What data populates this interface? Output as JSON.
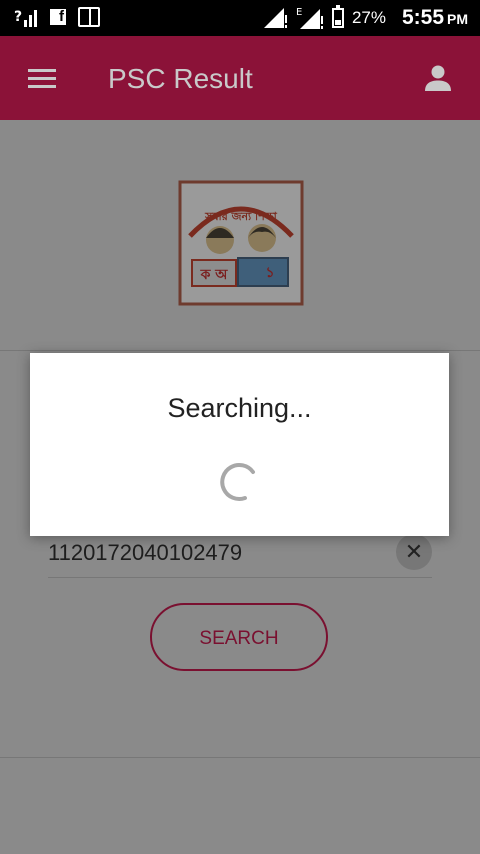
{
  "status_bar": {
    "battery_percent": "27%",
    "time": "5:55",
    "ampm": "PM",
    "signal_label": "E"
  },
  "app_bar": {
    "title": "PSC Result"
  },
  "form": {
    "roll_value": "1120172040102479",
    "search_label": "SEARCH"
  },
  "dialog": {
    "title": "Searching..."
  },
  "logo": {
    "text": "সবার জন্য শিক্ষা",
    "book_left": "ক অ",
    "book_right": "১"
  },
  "colors": {
    "primary": "#8b1238",
    "accent": "#c2185b"
  }
}
